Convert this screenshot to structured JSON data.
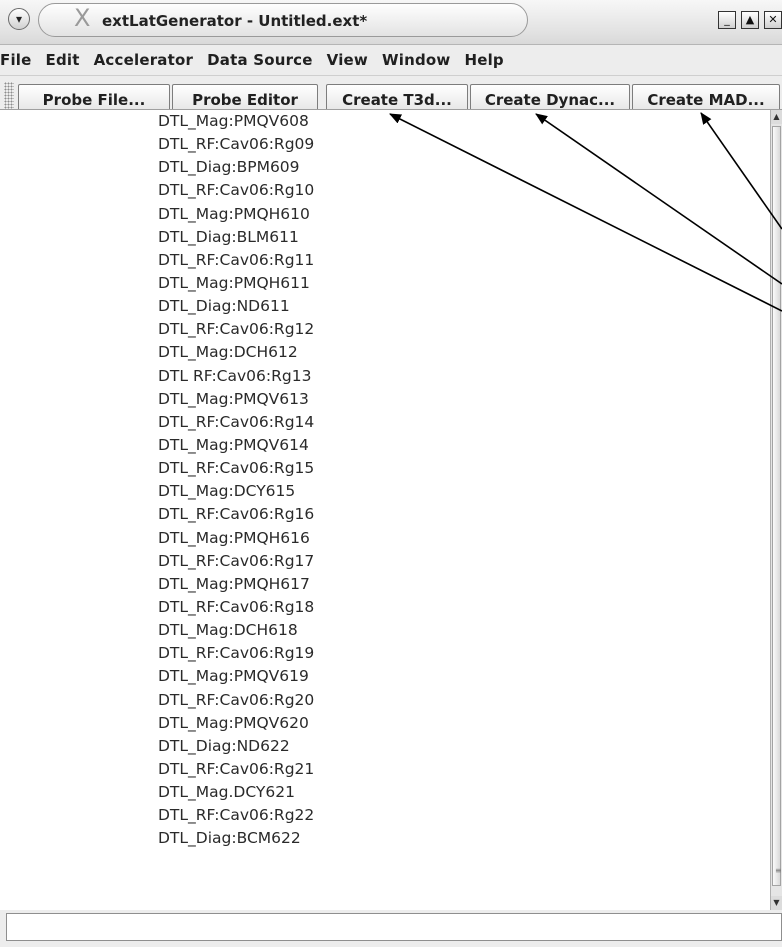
{
  "window": {
    "title": "extLatGenerator - Untitled.ext*",
    "menu_button_glyph": "▾",
    "logo_glyph": "X",
    "controls": {
      "minimize": "_",
      "maximize": "▲",
      "close": "✕"
    }
  },
  "menubar": {
    "items": [
      "File",
      "Edit",
      "Accelerator",
      "Data Source",
      "View",
      "Window",
      "Help"
    ]
  },
  "toolbar": {
    "buttons": [
      "Probe File...",
      "Probe Editor",
      "Create T3d...",
      "Create Dynac...",
      "Create MAD..."
    ]
  },
  "node_list": [
    "DTL_Mag:PMQV608",
    "DTL_RF:Cav06:Rg09",
    "DTL_Diag:BPM609",
    "DTL_RF:Cav06:Rg10",
    "DTL_Mag:PMQH610",
    "DTL_Diag:BLM611",
    "DTL_RF:Cav06:Rg11",
    "DTL_Mag:PMQH611",
    "DTL_Diag:ND611",
    "DTL_RF:Cav06:Rg12",
    "DTL_Mag:DCH612",
    "DTL RF:Cav06:Rg13",
    "DTL_Mag:PMQV613",
    "DTL_RF:Cav06:Rg14",
    "DTL_Mag:PMQV614",
    "DTL_RF:Cav06:Rg15",
    "DTL_Mag:DCY615",
    "DTL_RF:Cav06:Rg16",
    "DTL_Mag:PMQH616",
    "DTL_RF:Cav06:Rg17",
    "DTL_Mag:PMQH617",
    "DTL_RF:Cav06:Rg18",
    "DTL_Mag:DCH618",
    "DTL_RF:Cav06:Rg19",
    "DTL_Mag:PMQV619",
    "DTL_RF:Cav06:Rg20",
    "DTL_Mag:PMQV620",
    "DTL_Diag:ND622",
    "DTL_RF:Cav06:Rg21",
    "DTL_Mag.DCY621",
    "DTL_RF:Cav06:Rg22",
    "DTL_Diag:BCM622"
  ],
  "scrollbar": {
    "up_glyph": "▲",
    "down_glyph": "▼",
    "grip_glyph": "≡"
  },
  "status": {
    "value": ""
  },
  "colors": {
    "arrow": "#000000",
    "list_background": "#ffffff",
    "window_background": "#ededed"
  }
}
